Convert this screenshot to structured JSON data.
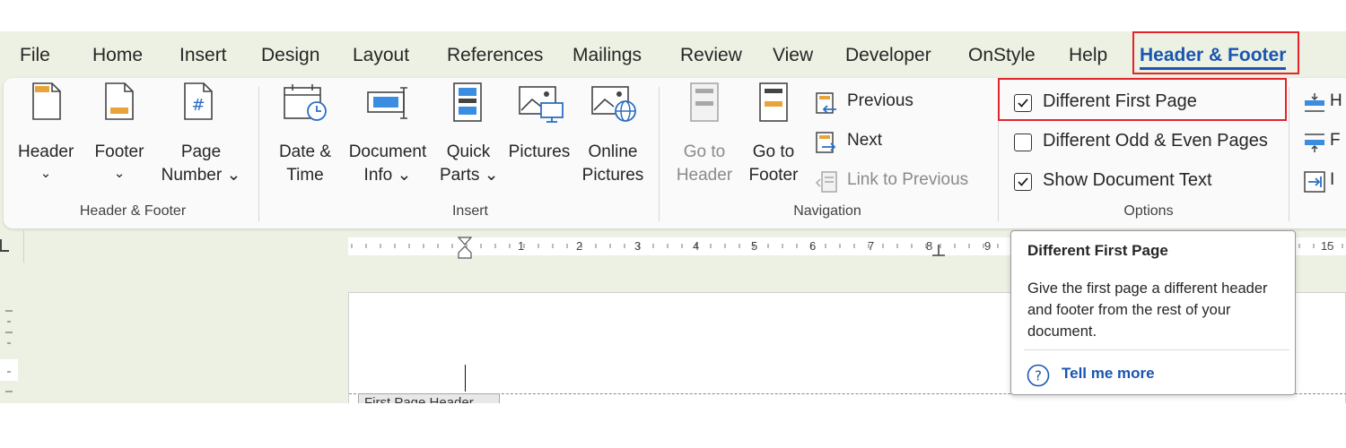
{
  "tabs": [
    {
      "label": "File",
      "active": false
    },
    {
      "label": "Home",
      "active": false
    },
    {
      "label": "Insert",
      "active": false
    },
    {
      "label": "Design",
      "active": false
    },
    {
      "label": "Layout",
      "active": false
    },
    {
      "label": "References",
      "active": false
    },
    {
      "label": "Mailings",
      "active": false
    },
    {
      "label": "Review",
      "active": false
    },
    {
      "label": "View",
      "active": false
    },
    {
      "label": "Developer",
      "active": false
    },
    {
      "label": "OnStyle",
      "active": false
    },
    {
      "label": "Help",
      "active": false
    },
    {
      "label": "Header & Footer",
      "active": true
    }
  ],
  "ribbon": {
    "header_footer": {
      "group_label": "Header & Footer",
      "header": {
        "line1": "Header",
        "line2": "⌄"
      },
      "footer": {
        "line1": "Footer",
        "line2": "⌄"
      },
      "page_number": {
        "line1": "Page",
        "line2": "Number ⌄"
      }
    },
    "insert": {
      "group_label": "Insert",
      "date_time": {
        "line1": "Date &",
        "line2": "Time"
      },
      "document_info": {
        "line1": "Document",
        "line2": "Info ⌄"
      },
      "quick_parts": {
        "line1": "Quick",
        "line2": "Parts ⌄"
      },
      "pictures": {
        "line1": "Pictures"
      },
      "online_pictures": {
        "line1": "Online",
        "line2": "Pictures"
      }
    },
    "navigation": {
      "group_label": "Navigation",
      "go_to_header": {
        "line1": "Go to",
        "line2": "Header"
      },
      "go_to_footer": {
        "line1": "Go to",
        "line2": "Footer"
      },
      "previous": "Previous",
      "next": "Next",
      "link_to_previous": "Link to Previous"
    },
    "options": {
      "group_label": "Options",
      "different_first_page": {
        "label": "Different First Page",
        "checked": true
      },
      "different_odd_even": {
        "label": "Different Odd & Even Pages",
        "checked": false
      },
      "show_document_text": {
        "label": "Show Document Text",
        "checked": true
      }
    },
    "position_partial": {
      "header_from_top": "H",
      "footer_from_bottom": "F",
      "insert_alignment_tab": "I"
    }
  },
  "ruler": {
    "numbers": [
      "1",
      "2",
      "3",
      "4",
      "5",
      "6",
      "7",
      "8",
      "9",
      "15"
    ]
  },
  "document": {
    "header_tag": "First Page Header"
  },
  "tooltip": {
    "title": "Different First Page",
    "body": "Give the first page a different header and footer from the rest of your document.",
    "link": "Tell me more"
  },
  "colors": {
    "accent": "#1a56b0",
    "highlight_box": "#e3242b",
    "icon_orange": "#e8a33a",
    "icon_blue": "#3b8de0",
    "app_background": "#edf1e3"
  }
}
